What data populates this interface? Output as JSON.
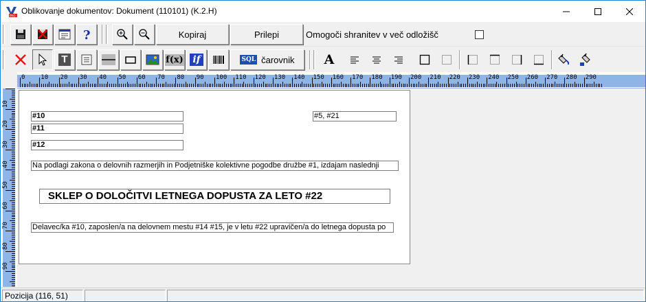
{
  "window": {
    "title": "Oblikovanje dokumentov: Dokument (110101)  (K.2.H)",
    "accent": "#1883d7"
  },
  "toolbar1": {
    "save_icon": "floppy-disk-icon",
    "cancel_icon": "red-x-floppy-icon",
    "properties_icon": "window-properties-icon",
    "help_icon": "question-mark-icon",
    "zoom_in_icon": "zoom-in-icon",
    "zoom_out_icon": "zoom-out-icon",
    "copy_label": "Kopiraj",
    "paste_label": "Prilepi",
    "store_later_label": "Omogoči shranitev v več odložišč",
    "store_later_checked": false
  },
  "toolbar2": {
    "delete_icon": "red-x-icon",
    "select_icon": "pointer-arrow-icon",
    "text_label": "T",
    "memo_icon": "memo-field-icon",
    "line_icon": "line-icon",
    "rect_icon": "rectangle-icon",
    "image_icon": "image-icon",
    "function_label": "f(x)",
    "if_label": "if",
    "barcode_icon": "barcode-icon",
    "sql_badge": "SQL",
    "wizard_label": "čarovnik",
    "font_label": "A",
    "align_left_icon": "align-left-icon",
    "align_center_icon": "align-center-icon",
    "align_right_icon": "align-right-icon",
    "border_all_icon": "border-all-icon",
    "border_none_icon": "border-none-icon",
    "border_left_icon": "border-left-icon",
    "border_top_icon": "border-top-icon",
    "border_right_icon": "border-right-icon",
    "border_bottom_icon": "border-bottom-icon",
    "fill_color_icon": "fill-bucket-icon",
    "fill_color2_icon": "fill-bucket-blue-icon"
  },
  "ruler": {
    "h_labels": [
      "0",
      "10",
      "20",
      "30",
      "40",
      "50",
      "60",
      "70",
      "80",
      "90",
      "100",
      "110",
      "120",
      "130",
      "140",
      "150",
      "160",
      "170",
      "180",
      "190",
      "200",
      "210",
      "220",
      "230",
      "240",
      "250",
      "260",
      "270",
      "280",
      "290"
    ],
    "v_labels": [
      "10",
      "20",
      "30",
      "40",
      "50",
      "60",
      "70",
      "80",
      "90"
    ]
  },
  "document": {
    "fields": [
      {
        "id": "f10",
        "text": "#10",
        "bold": true
      },
      {
        "id": "f5",
        "text": "#5, #21",
        "bold": false
      },
      {
        "id": "f11",
        "text": "#11",
        "bold": true
      },
      {
        "id": "f12",
        "text": "#12",
        "bold": true
      },
      {
        "id": "intro",
        "text": "Na podlagi zakona o delovnih razmerjih in Podjetniške kolektivne pogodbe družbe #1, izdajam naslednji",
        "bold": false
      },
      {
        "id": "title",
        "text": "SKLEP O DOLOČITVI LETNEGA DOPUSTA ZA LETO #22",
        "bold": true
      },
      {
        "id": "body",
        "text": "Delavec/ka #10, zaposlen/a na delovnem mestu #14 #15, je v letu #22 upravičen/a do letnega dopusta po",
        "bold": false
      }
    ]
  },
  "statusbar": {
    "position": "Pozicija (116, 51)",
    "panel2": "",
    "panel3": ""
  }
}
